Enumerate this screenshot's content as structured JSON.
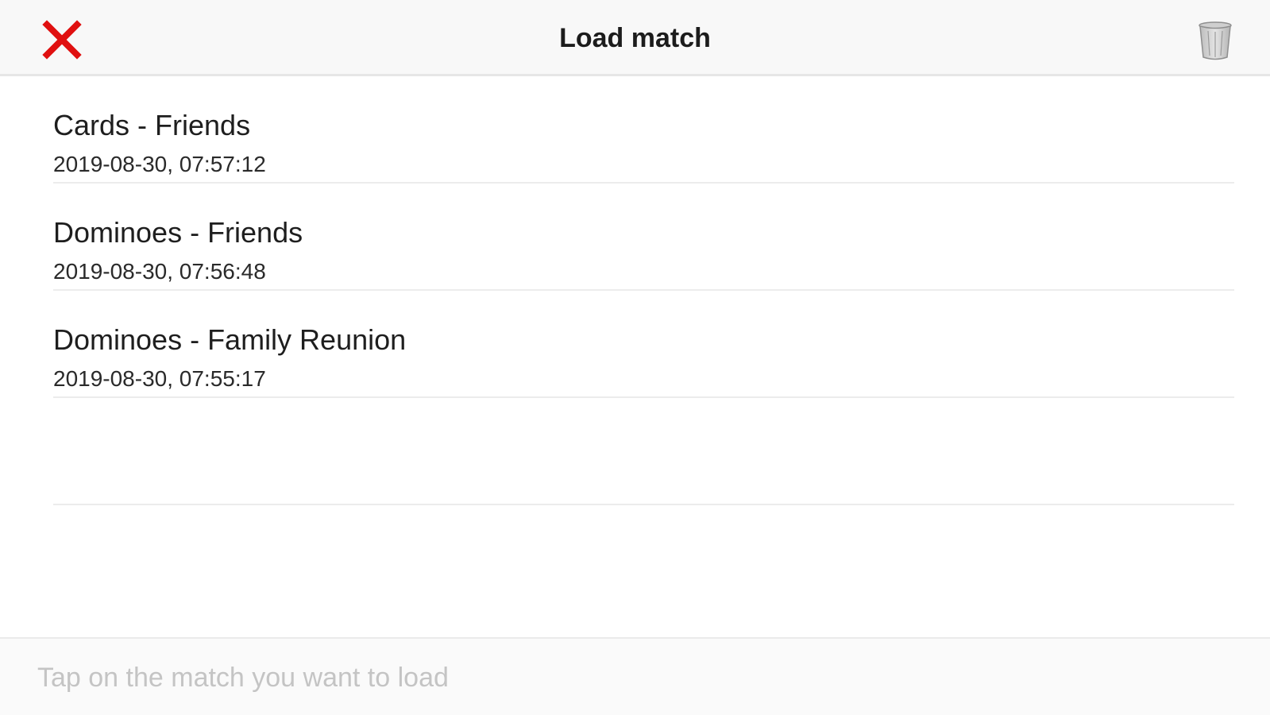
{
  "header": {
    "title": "Load match",
    "close_icon": "close-x-icon",
    "close_color": "#e01010",
    "trash_icon": "trash-icon"
  },
  "matches": [
    {
      "title": "Cards - Friends",
      "date": "2019-08-30, 07:57:12"
    },
    {
      "title": "Dominoes - Friends",
      "date": "2019-08-30, 07:56:48"
    },
    {
      "title": "Dominoes - Family Reunion",
      "date": "2019-08-30, 07:55:17"
    }
  ],
  "footer": {
    "hint": "Tap on the match you want to load"
  }
}
